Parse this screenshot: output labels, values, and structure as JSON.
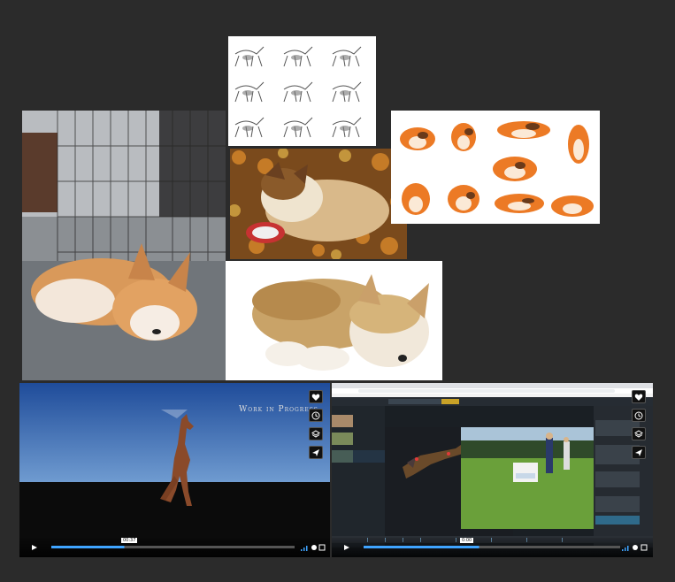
{
  "left_video": {
    "overlay_title": "Work in Progress",
    "timestamp": "00:37",
    "progress_fraction": 0.3
  },
  "right_video": {
    "address_bar": "https://sketchfab.com/dashboard/...",
    "timestamp": "0:00",
    "progress_fraction": 0.45
  },
  "side_icons": [
    "heart-icon",
    "clock-icon",
    "layers-icon",
    "send-icon"
  ],
  "colors": {
    "background": "#2b2b2b",
    "sky": "#4a78b8",
    "ground": "#0a0a0a",
    "progress": "#3fa4ff"
  }
}
